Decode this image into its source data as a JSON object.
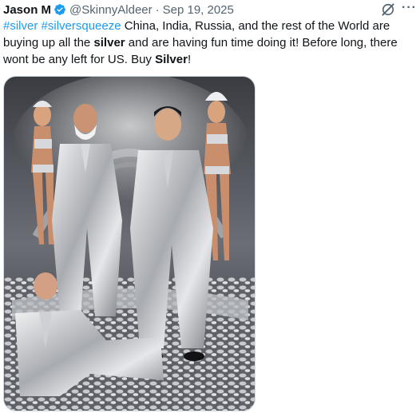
{
  "post": {
    "author_name": "Jason M",
    "handle": "@SkinnyAldeer",
    "separator": "·",
    "date": "Sep 19, 2025",
    "more_label": "···",
    "text_segments": [
      {
        "text": "#silver",
        "style": "hashtag"
      },
      {
        "text": " ",
        "style": "plain"
      },
      {
        "text": "#silversqueeze",
        "style": "hashtag"
      },
      {
        "text": " China, India, Russia, and the rest of the World are buying up all the ",
        "style": "plain"
      },
      {
        "text": "silver",
        "style": "bold"
      },
      {
        "text": " and are having fun time doing it! Before long, there wont be any left for US. Buy ",
        "style": "plain"
      },
      {
        "text": "Silver",
        "style": "bold"
      },
      {
        "text": "!",
        "style": "plain"
      }
    ]
  },
  "icons": {
    "verified": "verified-badge-icon",
    "grok": "grok-icon",
    "more": "more-icon"
  },
  "colors": {
    "text": "#0f1419",
    "secondary": "#536471",
    "link": "#1d9bf0",
    "verified": "#1d9bf0"
  }
}
